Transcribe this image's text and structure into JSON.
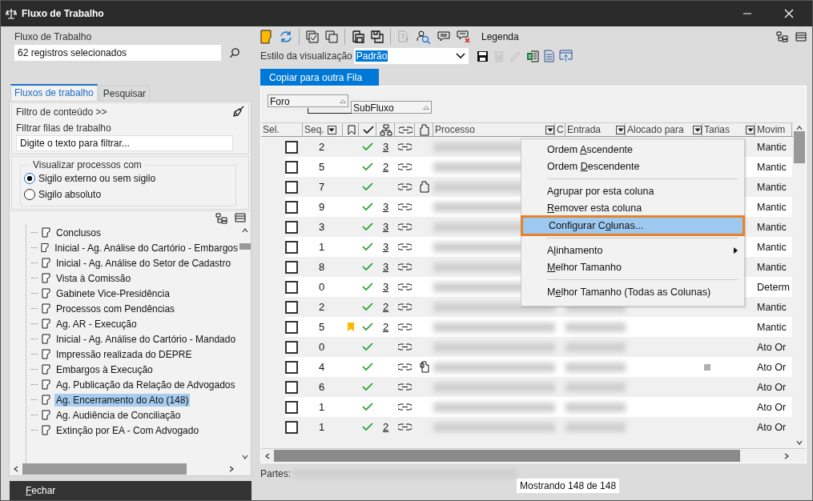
{
  "window": {
    "title": "Fluxo de Trabalho"
  },
  "left": {
    "field_label": "Fluxo de Trabalho",
    "field_value": "62 registros selecionados",
    "tabs": [
      {
        "label": "Fluxos de trabalho",
        "selected": true
      },
      {
        "label": "Pesquisar",
        "selected": false
      }
    ],
    "content_filter": "Filtro de conteúdo >>",
    "filter_label": "Filtrar filas de trabalho",
    "filter_placeholder": "Digite o texto para filtrar...",
    "visibility_group": "Visualizar processos com",
    "radios": [
      {
        "label": "Sigilo externo ou sem sigilo",
        "selected": true
      },
      {
        "label": "Sigilo absoluto",
        "selected": false
      }
    ],
    "tree": [
      {
        "label": "Conclusos",
        "selected": false
      },
      {
        "label": "Inicial - Ag. Análise do Cartório - Embargos",
        "selected": false
      },
      {
        "label": "Inicial - Ag. Análise do Setor de Cadastro",
        "selected": false
      },
      {
        "label": "Vista à Comissão",
        "selected": false
      },
      {
        "label": "Gabinete Vice-Presidência",
        "selected": false
      },
      {
        "label": "Processos com Pendências",
        "selected": false
      },
      {
        "label": "Ag. AR - Execução",
        "selected": false
      },
      {
        "label": "Inicial - Ag. Análise do Cartório - Mandado",
        "selected": false
      },
      {
        "label": "Impressão realizada do DEPRE",
        "selected": false
      },
      {
        "label": "Embargos à Execução",
        "selected": false
      },
      {
        "label": "Ag. Publicação da Relação de Advogados",
        "selected": false
      },
      {
        "label": "Ag. Encerramento do Ato (148)",
        "selected": true
      },
      {
        "label": "Ag. Audiência de Conciliação",
        "selected": false
      },
      {
        "label": "Extinção por EA - Com Advogado",
        "selected": false
      }
    ],
    "close_button": {
      "key": "F",
      "rest": "echar"
    }
  },
  "toolbar": {
    "legend": "Legenda",
    "style_label": "Estilo da visualização",
    "style_value": "Padrão",
    "copy_button": "Copiar para outra Fila"
  },
  "group_by": [
    "Foro",
    "SubFluxo"
  ],
  "columns": {
    "sel": "Sel.",
    "seq": "Seq.",
    "processo": "Processo",
    "c": "C",
    "entrada": "Entrada",
    "alocado": "Alocado para",
    "tarias": "Tarias",
    "movim": "Movim"
  },
  "rows": [
    {
      "checked": false,
      "seq": "2",
      "bookmarked": false,
      "subflows": "3",
      "document": false,
      "movement": "Mantic"
    },
    {
      "checked": false,
      "seq": "5",
      "bookmarked": false,
      "subflows": "2",
      "document": false,
      "movement": "Mantic"
    },
    {
      "checked": false,
      "seq": "7",
      "bookmarked": false,
      "document": true,
      "document_signed": false,
      "movement": "Mantic"
    },
    {
      "checked": false,
      "seq": "9",
      "bookmarked": false,
      "subflows": "3",
      "document": false,
      "movement": "Mantic"
    },
    {
      "checked": false,
      "seq": "3",
      "bookmarked": false,
      "subflows": "3",
      "document": false,
      "movement": "Mantic"
    },
    {
      "checked": false,
      "seq": "1",
      "bookmarked": false,
      "subflows": "3",
      "document": false,
      "movement": "Mantic"
    },
    {
      "checked": false,
      "seq": "8",
      "bookmarked": false,
      "subflows": "3",
      "document": false,
      "movement": "Mantic"
    },
    {
      "checked": false,
      "seq": "0",
      "bookmarked": false,
      "subflows": "3",
      "document": false,
      "movement": "Determ"
    },
    {
      "checked": false,
      "seq": "2",
      "bookmarked": false,
      "subflows": "2",
      "document": false,
      "marker": false,
      "movement": "Mantic"
    },
    {
      "checked": false,
      "seq": "5",
      "bookmarked": true,
      "subflows": "2",
      "document": false,
      "marker": false,
      "movement": "Mantic"
    },
    {
      "checked": false,
      "seq": "0",
      "bookmarked": false,
      "document": false,
      "marker": false,
      "movement": "Ato Or"
    },
    {
      "checked": false,
      "seq": "4",
      "bookmarked": false,
      "document": true,
      "document_signed": true,
      "marker": true,
      "movement": "Ato Or"
    },
    {
      "checked": false,
      "seq": "6",
      "bookmarked": false,
      "document": false,
      "marker": false,
      "movement": "Ato Or"
    },
    {
      "checked": false,
      "seq": "1",
      "bookmarked": false,
      "document": false,
      "marker": false,
      "movement": "Ato Or"
    },
    {
      "checked": false,
      "seq": "1",
      "bookmarked": false,
      "subflows": "2",
      "document": false,
      "marker": false,
      "movement": "Ato Or"
    }
  ],
  "context_menu": [
    {
      "kind": "item",
      "before": "Ordem ",
      "key": "A",
      "after": "scendente",
      "highlighted": false,
      "submenu": false
    },
    {
      "kind": "item",
      "before": "Ordem ",
      "key": "D",
      "after": "escendente",
      "highlighted": false,
      "submenu": false
    },
    {
      "kind": "separator"
    },
    {
      "kind": "item",
      "before": "A",
      "key": "g",
      "after": "rupar por esta coluna",
      "highlighted": false,
      "submenu": false
    },
    {
      "kind": "item",
      "key": "R",
      "after": "emover esta coluna",
      "highlighted": false,
      "submenu": false
    },
    {
      "kind": "item",
      "before": "Configurar C",
      "key": "o",
      "after": "lunas...",
      "highlighted": true,
      "submenu": false
    },
    {
      "kind": "separator"
    },
    {
      "kind": "item",
      "before": "A",
      "key": "l",
      "after": "inhamento",
      "highlighted": false,
      "submenu": true
    },
    {
      "kind": "item",
      "key": "M",
      "after": "elhor Tamanho",
      "highlighted": false,
      "submenu": false
    },
    {
      "kind": "separator"
    },
    {
      "kind": "item",
      "before": "M",
      "key": "e",
      "after": "lhor Tamanho (Todas as Colunas)",
      "highlighted": false,
      "submenu": false
    }
  ],
  "footer": {
    "parts_label": "Partes:",
    "count": "Mostrando 148 de 148"
  }
}
